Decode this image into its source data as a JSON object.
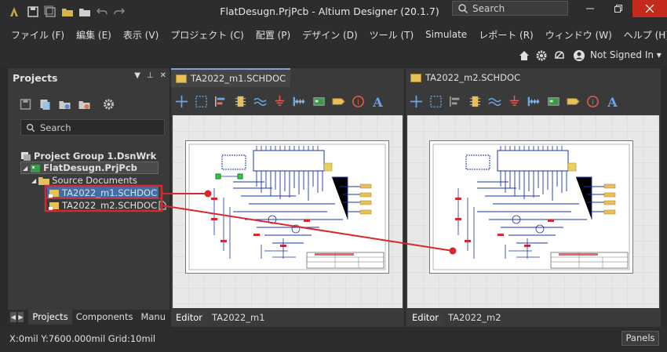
{
  "window": {
    "title": "FlatDesugn.PrjPcb - Altium Designer (20.1.7)",
    "search_placeholder": "Search"
  },
  "menu": {
    "items": [
      "ファイル (F)",
      "編集 (E)",
      "表示 (V)",
      "プロジェクト (C)",
      "配置 (P)",
      "デザイン (D)",
      "ツール (T)",
      "Simulate",
      "レポート (R)",
      "ウィンドウ (W)",
      "ヘルプ (H)"
    ]
  },
  "toolbar": {
    "user_label": "Not Signed In"
  },
  "projects_panel": {
    "title": "Projects",
    "search_placeholder": "Search",
    "tree": {
      "group": "Project Group 1.DsnWrk",
      "project": "FlatDesugn.PrjPcb",
      "folder": "Source Documents",
      "doc1": "TA2022_m1.SCHDOC",
      "doc2": "TA2022_m2.SCHDOC"
    },
    "tabs": [
      "Projects",
      "Components",
      "Manu"
    ]
  },
  "documents": {
    "left": {
      "tab": "TA2022_m1.SCHDOC",
      "bottom_tabs": [
        "Editor",
        "TA2022_m1"
      ]
    },
    "right": {
      "tab": "TA2022_m2.SCHDOC",
      "bottom_tabs": [
        "Editor",
        "TA2022_m2"
      ]
    }
  },
  "status": {
    "text": "X:0mil Y:7600.000mil   Grid:10mil",
    "panels_button": "Panels"
  },
  "colors": {
    "highlight_red": "#d9272e",
    "selection_blue": "#3f6ea8",
    "wire_blue": "#1a33a8"
  }
}
